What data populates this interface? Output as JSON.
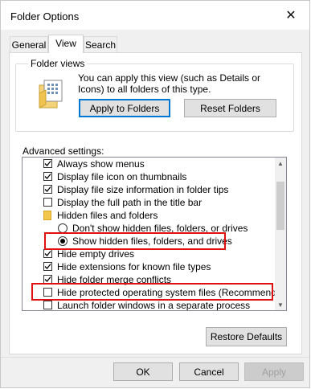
{
  "window": {
    "title": "Folder Options"
  },
  "tabs": [
    {
      "label": "General",
      "active": false
    },
    {
      "label": "View",
      "active": true
    },
    {
      "label": "Search",
      "active": false
    }
  ],
  "folder_views": {
    "title": "Folder views",
    "description": "You can apply this view (such as Details or Icons) to all folders of this type.",
    "apply_label": "Apply to Folders",
    "reset_label": "Reset Folders"
  },
  "advanced": {
    "label": "Advanced settings:",
    "items": [
      {
        "type": "checkbox",
        "checked": true,
        "label": "Always show menus"
      },
      {
        "type": "checkbox",
        "checked": true,
        "label": "Display file icon on thumbnails"
      },
      {
        "type": "checkbox",
        "checked": true,
        "label": "Display file size information in folder tips"
      },
      {
        "type": "checkbox",
        "checked": false,
        "label": "Display the full path in the title bar"
      },
      {
        "type": "folder",
        "label": "Hidden files and folders"
      },
      {
        "type": "radio",
        "checked": false,
        "label": "Don't show hidden files, folders, or drives"
      },
      {
        "type": "radio",
        "checked": true,
        "label": "Show hidden files, folders, and drives"
      },
      {
        "type": "checkbox",
        "checked": true,
        "label": "Hide empty drives"
      },
      {
        "type": "checkbox",
        "checked": true,
        "label": "Hide extensions for known file types"
      },
      {
        "type": "checkbox",
        "checked": true,
        "label": "Hide folder merge conflicts"
      },
      {
        "type": "checkbox",
        "checked": false,
        "label": "Hide protected operating system files (Recommended)"
      },
      {
        "type": "checkbox",
        "checked": false,
        "label": "Launch folder windows in a separate process"
      }
    ],
    "restore_label": "Restore Defaults"
  },
  "footer": {
    "ok_label": "OK",
    "cancel_label": "Cancel",
    "apply_label": "Apply"
  },
  "colors": {
    "highlight": "#e01010",
    "focus": "#0078d7"
  }
}
